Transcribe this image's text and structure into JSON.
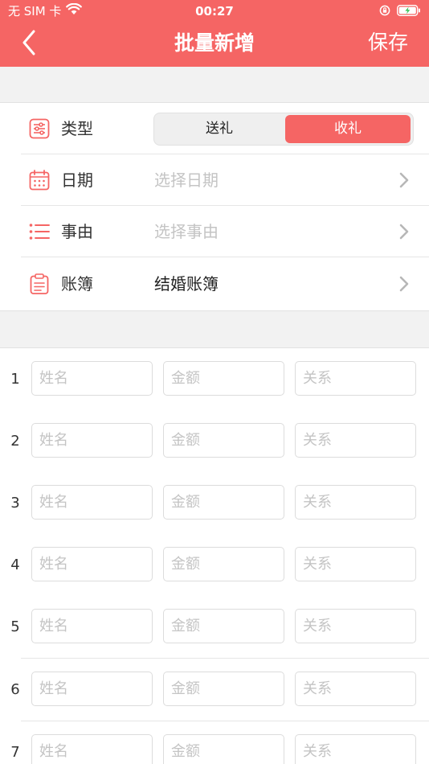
{
  "status_bar": {
    "carrier": "无 SIM 卡",
    "time": "00:27"
  },
  "nav": {
    "title": "批量新增",
    "save_label": "保存",
    "back_icon": "chevron-left-icon"
  },
  "colors": {
    "brand": "#f56564",
    "placeholder": "#c4c4c4",
    "background": "#f2f2f2"
  },
  "form": {
    "type": {
      "label": "类型",
      "icon": "sliders-icon",
      "options": [
        "送礼",
        "收礼"
      ],
      "selected": "收礼"
    },
    "date": {
      "label": "日期",
      "icon": "calendar-icon",
      "placeholder": "选择日期"
    },
    "reason": {
      "label": "事由",
      "icon": "list-icon",
      "placeholder": "选择事由"
    },
    "ledger": {
      "label": "账簿",
      "icon": "clipboard-icon",
      "value": "结婚账簿"
    }
  },
  "entries": {
    "name_placeholder": "姓名",
    "amount_placeholder": "金额",
    "relation_placeholder": "关系",
    "rows": [
      "1",
      "2",
      "3",
      "4",
      "5",
      "6",
      "7"
    ]
  }
}
